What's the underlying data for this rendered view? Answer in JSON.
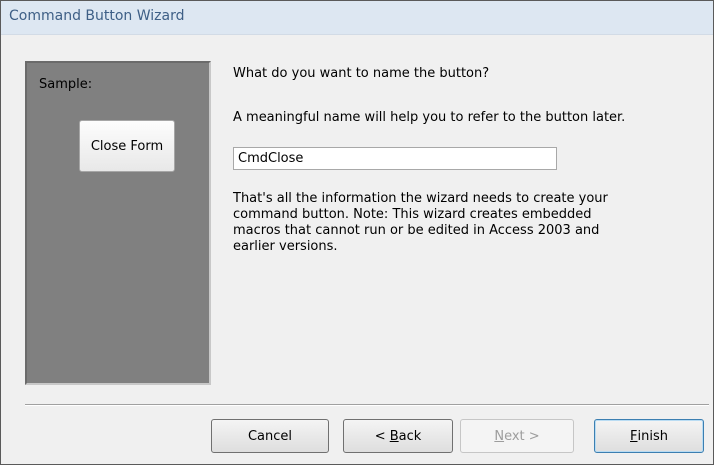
{
  "window": {
    "title": "Command Button Wizard"
  },
  "sample": {
    "label": "Sample:",
    "button_label": "Close Form"
  },
  "prompt": {
    "question": "What do you want to name the button?",
    "hint": "A meaningful name will help you to refer to the button later.",
    "name_value": "CmdClose",
    "info_lines": [
      "That's all the information the wizard needs to create your",
      "command button. Note: This wizard creates embedded",
      "macros that cannot run or be edited in Access 2003 and",
      "earlier versions."
    ]
  },
  "buttons": {
    "cancel": "Cancel",
    "back": {
      "prefix": "< ",
      "accel": "B",
      "rest": "ack"
    },
    "next": {
      "accel": "N",
      "rest": "ext >",
      "enabled": false
    },
    "finish": {
      "accel": "F",
      "rest": "inish"
    }
  }
}
